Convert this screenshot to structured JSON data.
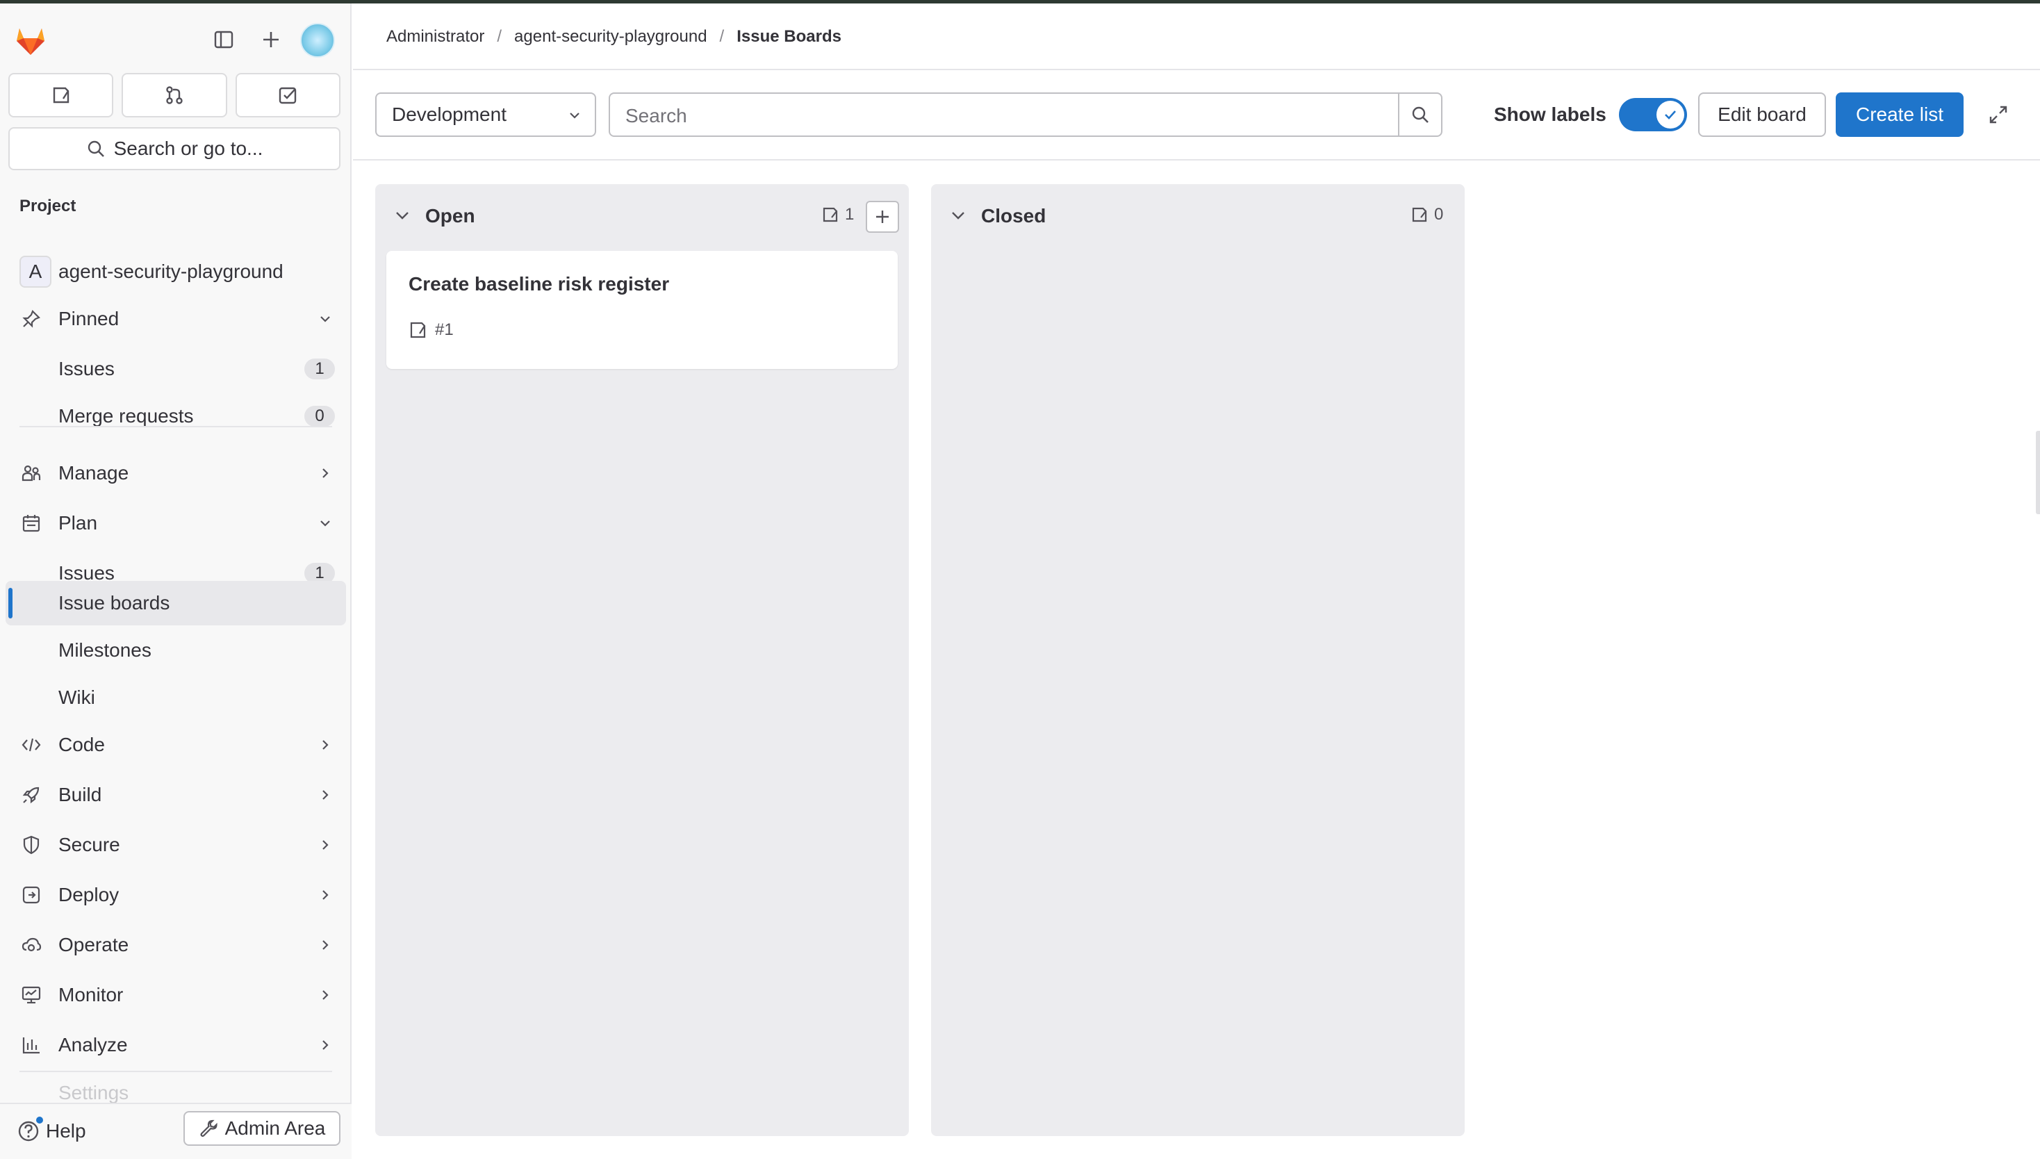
{
  "sidebar": {
    "search_label": "Search or go to...",
    "section_title": "Project",
    "project": {
      "badge": "A",
      "name": "agent-security-playground"
    },
    "pinned": {
      "label": "Pinned",
      "items": [
        {
          "label": "Issues",
          "count": "1"
        },
        {
          "label": "Merge requests",
          "count": "0"
        }
      ]
    },
    "manage_label": "Manage",
    "plan": {
      "label": "Plan",
      "items": [
        {
          "label": "Issues",
          "count": "1"
        },
        {
          "label": "Issue boards",
          "active": true
        },
        {
          "label": "Milestones"
        },
        {
          "label": "Wiki"
        }
      ]
    },
    "groups": [
      {
        "label": "Code",
        "icon": "code-icon"
      },
      {
        "label": "Build",
        "icon": "rocket-icon"
      },
      {
        "label": "Secure",
        "icon": "shield-icon"
      },
      {
        "label": "Deploy",
        "icon": "deploy-icon"
      },
      {
        "label": "Operate",
        "icon": "cloud-gear-icon"
      },
      {
        "label": "Monitor",
        "icon": "monitor-icon"
      },
      {
        "label": "Analyze",
        "icon": "chart-icon"
      }
    ],
    "faded_item": "Settings",
    "help_label": "Help",
    "admin_label": "Admin Area"
  },
  "breadcrumb": {
    "items": [
      "Administrator",
      "agent-security-playground"
    ],
    "current": "Issue Boards"
  },
  "toolbar": {
    "board_select_value": "Development",
    "search_placeholder": "Search",
    "show_labels_label": "Show labels",
    "show_labels_on": true,
    "edit_board_label": "Edit board",
    "create_list_label": "Create list"
  },
  "board": {
    "lists": [
      {
        "title": "Open",
        "count": "1",
        "cards": [
          {
            "title": "Create baseline risk register",
            "ref": "#1"
          }
        ]
      },
      {
        "title": "Closed",
        "count": "0",
        "cards": []
      }
    ]
  },
  "colors": {
    "accent": "#1f75cb",
    "sidebar_bg": "#f8f8f8",
    "list_bg": "#ececef",
    "gitlab_orange": "#e24329"
  }
}
